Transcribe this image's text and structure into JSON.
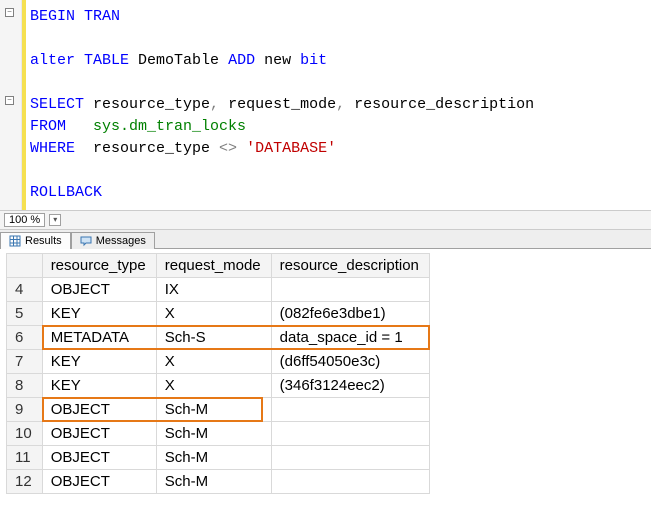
{
  "editor": {
    "l1a": "BEGIN",
    "l1b": " TRAN",
    "l2": "",
    "l3a": "alter",
    "l3b": " TABLE",
    "l3c": " DemoTable ",
    "l3d": "ADD",
    "l3e": " new ",
    "l3f": "bit",
    "l4": "",
    "l5a": "SELECT",
    "l5b": " resource_type",
    "l5c": ",",
    "l5d": " request_mode",
    "l5e": ",",
    "l5f": " resource_description",
    "l6a": "FROM",
    "l6b": "   ",
    "l6c": "sys.dm_tran_locks",
    "l7a": "WHERE",
    "l7b": "  resource_type ",
    "l7c": "<>",
    "l7d": " ",
    "l7e": "'DATABASE'",
    "l8": "",
    "l9a": "ROLLBACK"
  },
  "zoom": "100 %",
  "tabs": {
    "results": "Results",
    "messages": "Messages"
  },
  "grid": {
    "headers": {
      "c1": "resource_type",
      "c2": "request_mode",
      "c3": "resource_description"
    },
    "rows": [
      {
        "n": "4",
        "c1": "OBJECT",
        "c2": "IX",
        "c3": ""
      },
      {
        "n": "5",
        "c1": "KEY",
        "c2": "X",
        "c3": "(082fe6e3dbe1)"
      },
      {
        "n": "6",
        "c1": "METADATA",
        "c2": "Sch-S",
        "c3": "data_space_id = 1"
      },
      {
        "n": "7",
        "c1": "KEY",
        "c2": "X",
        "c3": "(d6ff54050e3c)"
      },
      {
        "n": "8",
        "c1": "KEY",
        "c2": "X",
        "c3": "(346f3124eec2)"
      },
      {
        "n": "9",
        "c1": "OBJECT",
        "c2": "Sch-M",
        "c3": ""
      },
      {
        "n": "10",
        "c1": "OBJECT",
        "c2": "Sch-M",
        "c3": ""
      },
      {
        "n": "11",
        "c1": "OBJECT",
        "c2": "Sch-M",
        "c3": ""
      },
      {
        "n": "12",
        "c1": "OBJECT",
        "c2": "Sch-M",
        "c3": ""
      }
    ]
  }
}
